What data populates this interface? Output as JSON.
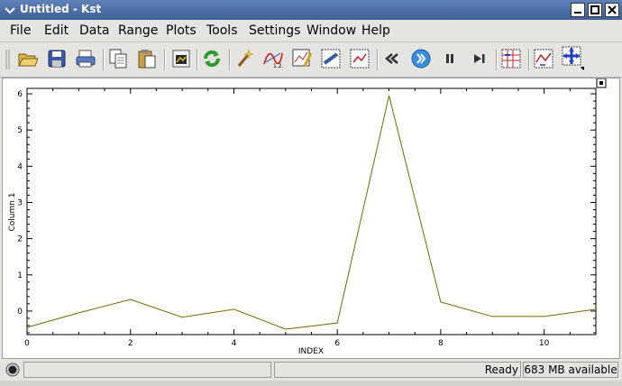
{
  "window": {
    "title": "Untitled - Kst"
  },
  "menu": [
    "File",
    "Edit",
    "Data",
    "Range",
    "Plots",
    "Tools",
    "Settings",
    "Window",
    "Help"
  ],
  "toolbar": {
    "buttons": [
      "open-icon",
      "save-icon",
      "print-icon",
      "copy-icon",
      "paste-icon",
      "export-image-icon",
      "reload-icon",
      "data-wizard-icon",
      "new-curve-icon",
      "new-equation-icon",
      "new-histogram-icon",
      "new-plugin-icon",
      "back-icon",
      "play-icon",
      "pause-icon",
      "advance-end-icon",
      "zoom-layout-icon",
      "graph-icon",
      "zoom-xy-icon"
    ]
  },
  "status": {
    "ready": "Ready",
    "memory": "683 MB available"
  },
  "chart_data": {
    "type": "line",
    "xlabel": "INDEX",
    "ylabel": "Column 1",
    "x": [
      0,
      1,
      2,
      3,
      4,
      5,
      6,
      7,
      8,
      9,
      10,
      11
    ],
    "series": [
      {
        "values": [
          -0.45,
          -0.05,
          0.32,
          -0.17,
          0.05,
          -0.5,
          -0.33,
          5.95,
          0.25,
          -0.15,
          -0.15,
          0.05
        ],
        "color": "#6b6b00"
      }
    ],
    "xlim": [
      0,
      11
    ],
    "ylim": [
      -0.65,
      6.15
    ],
    "xticks": [
      0,
      2,
      4,
      6,
      8,
      10
    ],
    "yticks": [
      0,
      1,
      2,
      3,
      4,
      5,
      6
    ],
    "grid": false
  }
}
